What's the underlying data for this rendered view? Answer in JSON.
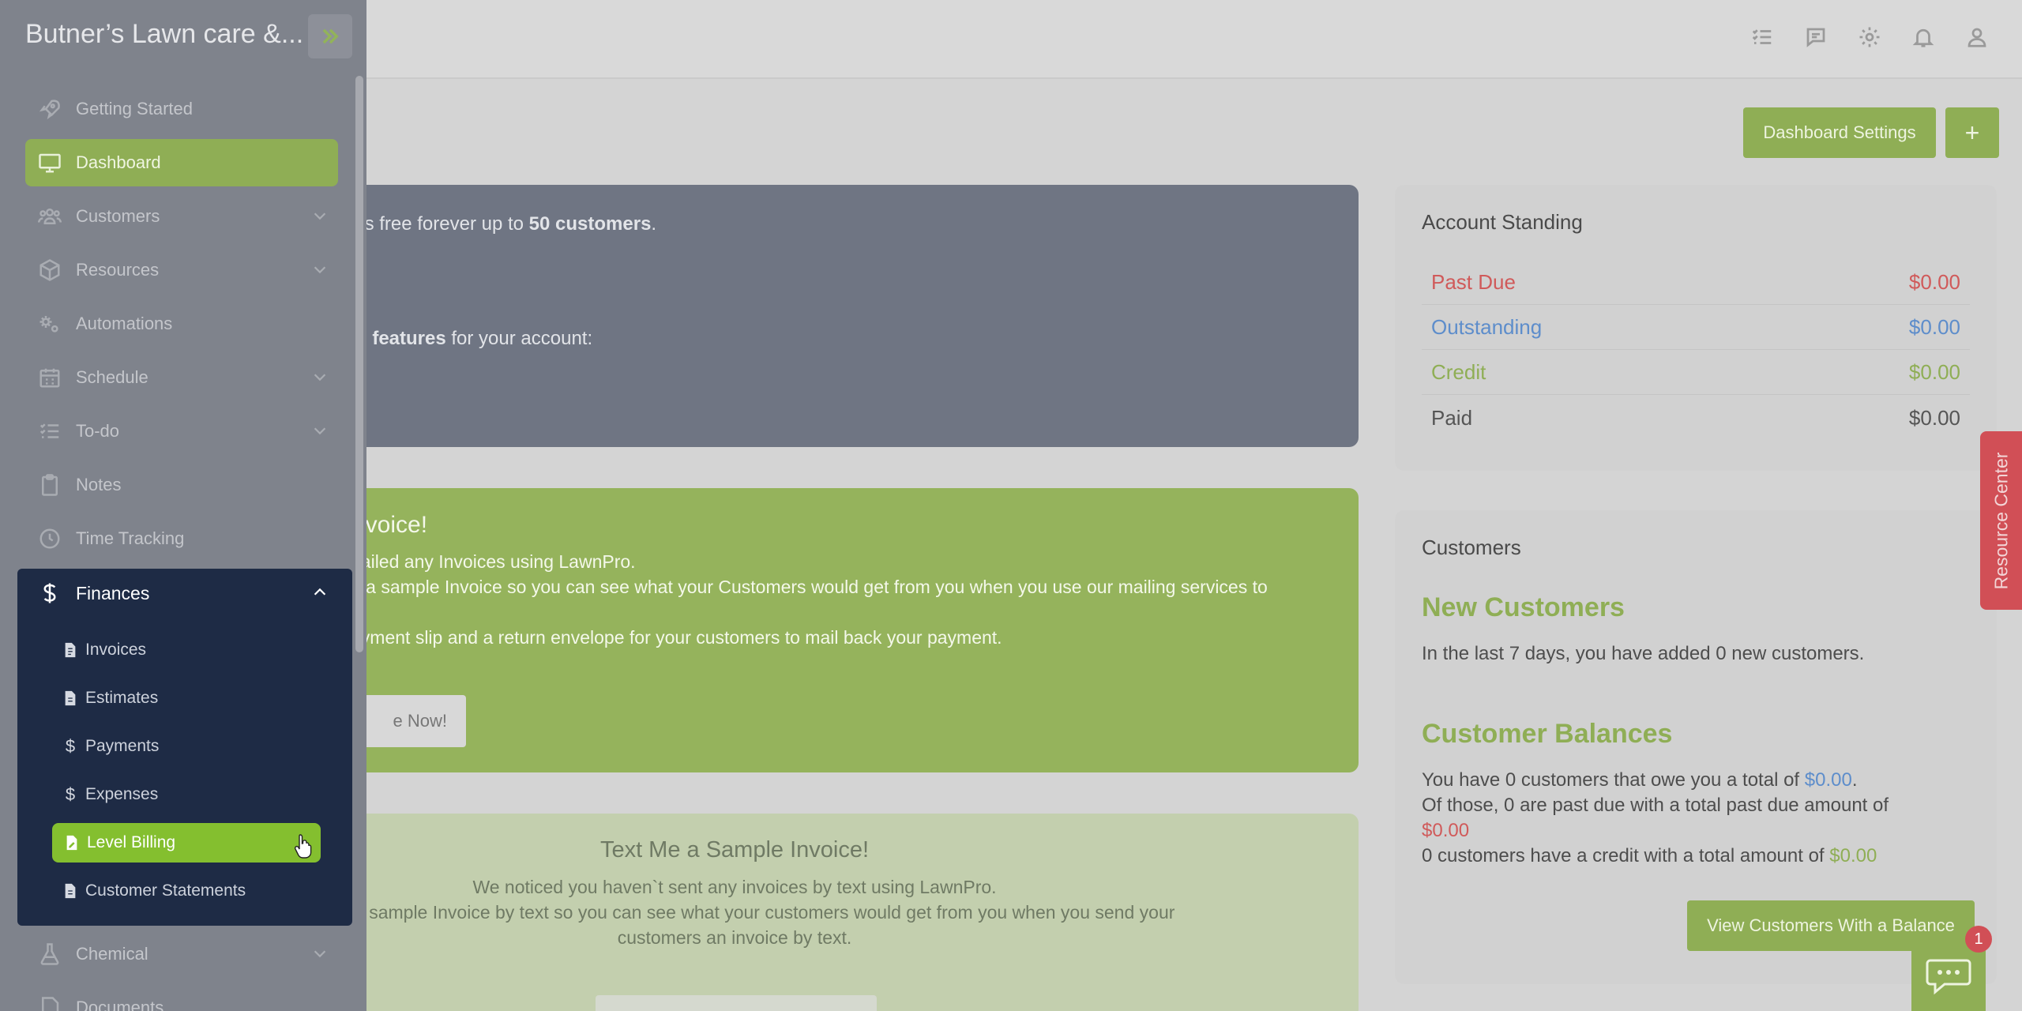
{
  "sidebar": {
    "brand": "Butner’s Lawn care &...",
    "items": [
      {
        "label": "Getting Started",
        "icon": "rocket-icon"
      },
      {
        "label": "Dashboard",
        "icon": "monitor-icon",
        "active": true
      },
      {
        "label": "Customers",
        "icon": "users-icon",
        "chevron": true
      },
      {
        "label": "Resources",
        "icon": "box-icon",
        "chevron": true
      },
      {
        "label": "Automations",
        "icon": "gears-icon"
      },
      {
        "label": "Schedule",
        "icon": "calendar-icon",
        "chevron": true
      },
      {
        "label": "To-do",
        "icon": "list-check-icon",
        "chevron": true
      },
      {
        "label": "Notes",
        "icon": "clipboard-icon"
      },
      {
        "label": "Time Tracking",
        "icon": "clock-icon"
      },
      {
        "label": "Finances",
        "icon": "dollar-icon",
        "expanded": true
      },
      {
        "label": "Chemical",
        "icon": "flask-icon",
        "chevron": true
      },
      {
        "label": "Documents",
        "icon": "file-icon"
      }
    ],
    "finances_sub": [
      {
        "label": "Invoices",
        "icon": "invoice-icon"
      },
      {
        "label": "Estimates",
        "icon": "file-icon"
      },
      {
        "label": "Payments",
        "icon": "dollar-icon"
      },
      {
        "label": "Expenses",
        "icon": "dollar-icon"
      },
      {
        "label": "Level Billing",
        "icon": "edit-file-icon",
        "active": true
      },
      {
        "label": "Customer Statements",
        "icon": "file-icon"
      }
    ]
  },
  "header": {
    "dashboard_settings": "Dashboard Settings",
    "add": "+"
  },
  "welcome": {
    "line1_pre": "t’s free forever up to ",
    "line1_bold": "50 customers",
    "line1_post": ".",
    "line2_bold": "n features",
    "line2_post": " for your account:"
  },
  "mail_invoice": {
    "title": "nvoice!",
    "p1": "nailed any Invoices using LawnPro.",
    "p2": "u a sample Invoice so you can see what your Customers would get from you when you use our mailing services to",
    "p3": "ayment slip and a return envelope for your customers to mail back your payment.",
    "button": "e Now!"
  },
  "text_invoice": {
    "title": "Text Me a Sample Invoice!",
    "p1": "We noticed you haven`t sent any invoices by text using LawnPro.",
    "p2": "nd you a sample Invoice by text so you can see what your customers would get from you when you send your",
    "p3": "customers an invoice by text."
  },
  "account_standing": {
    "title": "Account Standing",
    "rows": [
      {
        "label": "Past Due",
        "value": "$0.00",
        "color": "#d05a5a"
      },
      {
        "label": "Outstanding",
        "value": "$0.00",
        "color": "#5d8dcb"
      },
      {
        "label": "Credit",
        "value": "$0.00",
        "color": "#8fae55"
      },
      {
        "label": "Paid",
        "value": "$0.00",
        "color": "#555555"
      }
    ]
  },
  "customers": {
    "title": "Customers",
    "new_heading": "New Customers",
    "new_text": "In the last 7 days, you have added 0 new customers.",
    "balances_heading": "Customer Balances",
    "bal_line1_pre": "You have 0 customers that owe you a total of ",
    "bal_line1_amount": "$0.00",
    "bal_line1_post": ".",
    "bal_line2": "Of those, 0 are past due with a total past due amount of",
    "bal_line2_amount": "$0.00",
    "bal_line3_pre": "0 customers have a credit with a total amount of ",
    "bal_line3_amount": "$0.00",
    "button": "View Customers With a Balance"
  },
  "resource_center": "Resource Center",
  "chat_badge": "1",
  "colors": {
    "brand_green": "#8fae55",
    "active_sub": "#84bf2f",
    "finances_bg": "#1e2b45",
    "danger": "#d05a5a",
    "info": "#5d8dcb"
  }
}
